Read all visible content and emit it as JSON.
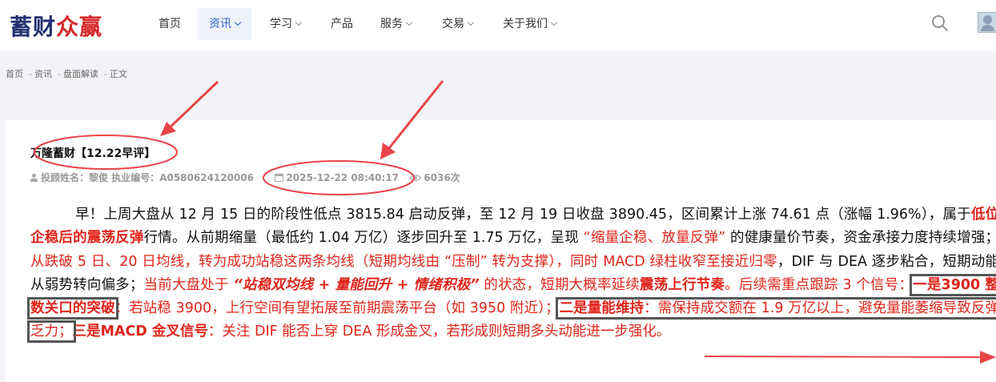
{
  "header": {
    "logo": {
      "part1": "蓄财",
      "part2": "众赢"
    },
    "nav": [
      {
        "label": "首页",
        "has_dropdown": false,
        "active": false
      },
      {
        "label": "资讯",
        "has_dropdown": true,
        "active": true
      },
      {
        "label": "学习",
        "has_dropdown": true,
        "active": false
      },
      {
        "label": "产品",
        "has_dropdown": false,
        "active": false
      },
      {
        "label": "服务",
        "has_dropdown": true,
        "active": false
      },
      {
        "label": "交易",
        "has_dropdown": true,
        "active": false
      },
      {
        "label": "关于我们",
        "has_dropdown": true,
        "active": false
      }
    ],
    "search_icon": "search-icon",
    "avatar_icon": "user-avatar-icon"
  },
  "breadcrumb": [
    "首页",
    "资讯",
    "盘面解读",
    "正文"
  ],
  "breadcrumb_separator": "-",
  "article": {
    "title": "万隆蓄财【12.22早评】",
    "meta": {
      "advisor": "投顾姓名：黎俊 执业编号：A0580624120006",
      "datetime": "2025-12-22 08:40:17",
      "views": "6036次"
    },
    "body": [
      {
        "text": "早！上周大盘从 12 月 15 日的阶段性低点 3815.84 启动反弹，至 12 月 19 日收盘 3890.45，区间累计上涨 74.61 点（涨幅 1.96%），属于",
        "style": "normal"
      },
      {
        "text": "低位企稳后的震荡反弹",
        "style": "red-bold"
      },
      {
        "text": "行情。从前期缩量（最低约 1.04 万亿）逐步回升至 1.75 万亿，呈现 ",
        "style": "normal"
      },
      {
        "text": "“缩量企稳、放量反弹”",
        "style": "red"
      },
      {
        "text": " 的健康量价节奏，资金承接力度持续增强；",
        "style": "normal"
      },
      {
        "text": "从跌破 5 日、20 日均线，转为成功站稳这两条均线（短期均线由 “压制” 转为支撑），同时 MACD 绿柱收窄至接近归零",
        "style": "red"
      },
      {
        "text": "，DIF 与 DEA 逐步粘合，短期动能从弱势转向偏多；",
        "style": "normal"
      },
      {
        "text": "当前大盘处于 ",
        "style": "red"
      },
      {
        "text": "“站稳双均线 + 量能回升 + 情绪积极”",
        "style": "red-bold-italic"
      },
      {
        "text": " 的状态，短期大概率延续",
        "style": "red"
      },
      {
        "text": "震荡上行节奏",
        "style": "red-bold"
      },
      {
        "text": "。后续需重点跟踪 3 个信号：",
        "style": "red"
      },
      {
        "text": "一是3900 整数关口的突破",
        "style": "red-bold-boxed"
      },
      {
        "text": "：若站稳 3900，上行空间有望拓展至前期震荡平台（如 3950 附近）；",
        "style": "red"
      },
      {
        "text": "二是量能维持",
        "style": "red-bold-boxed-start"
      },
      {
        "text": "：需保持成交额在 1.9 万亿以上，避免量能萎缩导致反弹乏力；",
        "style": "red-boxed-end"
      },
      {
        "text": "三是MACD 金叉信号",
        "style": "red-bold"
      },
      {
        "text": "：关注 DIF 能否上穿 DEA 形成金叉，若形成则短期多头动能进一步强化。",
        "style": "red"
      }
    ]
  },
  "colors": {
    "accent_blue": "#2a64c9",
    "highlight_red": "#e0251b",
    "annotation_red": "#e8454a",
    "logo_navy": "#23326f"
  }
}
